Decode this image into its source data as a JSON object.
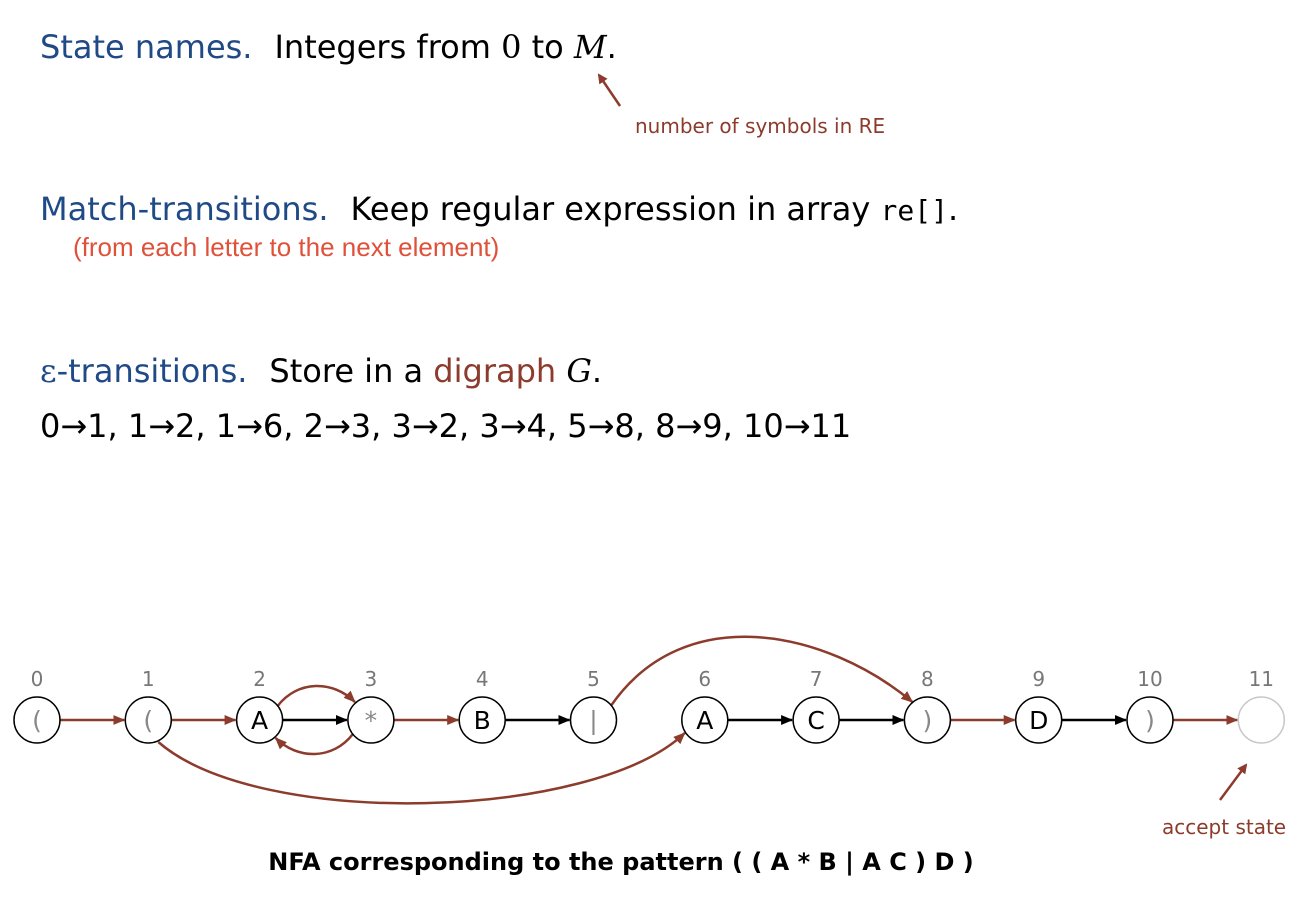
{
  "state_names": {
    "heading": "State names.",
    "text_before": "Integers from",
    "zero": "0",
    "to": "to",
    "m": "M",
    "period": "."
  },
  "note_symbols": "number of symbols in RE",
  "match": {
    "heading": "Match-transitions.",
    "text": "Keep regular expression in array",
    "code": "re[]",
    "period": ".",
    "note": "(from each letter to the next element)"
  },
  "eps": {
    "epsilon": "ε",
    "heading": "-transitions.",
    "text": "Store in a",
    "digraph": "digraph",
    "g": "G",
    "period": ".",
    "edges": "0→1, 1→2, 1→6,  2→3,  3→2,  3→4,  5→8,  8→9,  10→11"
  },
  "nfa": {
    "states": [
      {
        "index": "0",
        "symbol": "("
      },
      {
        "index": "1",
        "symbol": "("
      },
      {
        "index": "2",
        "symbol": "A"
      },
      {
        "index": "3",
        "symbol": "*"
      },
      {
        "index": "4",
        "symbol": "B"
      },
      {
        "index": "5",
        "symbol": "|"
      },
      {
        "index": "6",
        "symbol": "A"
      },
      {
        "index": "7",
        "symbol": "C"
      },
      {
        "index": "8",
        "symbol": ")"
      },
      {
        "index": "9",
        "symbol": "D"
      },
      {
        "index": "10",
        "symbol": ")"
      },
      {
        "index": "11",
        "symbol": ""
      }
    ],
    "match_transitions": [
      [
        2,
        3
      ],
      [
        4,
        5
      ],
      [
        6,
        7
      ],
      [
        7,
        8
      ],
      [
        9,
        10
      ]
    ],
    "epsilon_transitions": [
      [
        0,
        1
      ],
      [
        1,
        2
      ],
      [
        1,
        6
      ],
      [
        2,
        3
      ],
      [
        3,
        2
      ],
      [
        3,
        4
      ],
      [
        5,
        8
      ],
      [
        8,
        9
      ],
      [
        10,
        11
      ]
    ],
    "accept_label": "accept state",
    "caption": "NFA corresponding to the pattern ( ( A * B | A C ) D )"
  },
  "colors": {
    "heading": "#1f4a86",
    "epsilon_edge": "#8c3b2c",
    "match_edge": "#000000",
    "note_red": "#e0513a"
  }
}
